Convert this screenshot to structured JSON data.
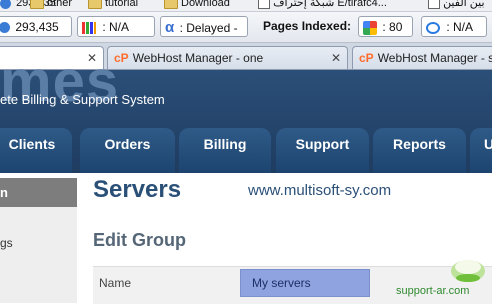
{
  "bookmarks": {
    "counter": "293,435",
    "items": [
      "other",
      "tutorial",
      "Download"
    ],
    "arabic_item": "شبكة إحتراف E/tirafc4...",
    "arabic_right": "بين الفين"
  },
  "toolbar": {
    "alexa_value": "N/A",
    "delayed_label": "Delayed -",
    "pages_indexed_label": "Pages Indexed:",
    "google_count": "80",
    "bing_value": "N/A"
  },
  "tabs": [
    {
      "label": "",
      "active": true
    },
    {
      "label": "WebHost Manager - one",
      "active": false
    },
    {
      "label": "WebHost Manager - s",
      "active": false
    }
  ],
  "header": {
    "logo_text": "mes",
    "tagline": "ete Billing & Support System",
    "nav": [
      "Clients",
      "Orders",
      "Billing",
      "Support",
      "Reports",
      "U"
    ]
  },
  "sidebar": {
    "active_label": "n",
    "item_label": "gs"
  },
  "main": {
    "title": "Servers",
    "domain": "www.multisoft-sy.com",
    "subtitle": "Edit Group",
    "name_label": "Name",
    "name_value": "My servers"
  },
  "watermark": {
    "text": "support-ar.com"
  },
  "colors": {
    "header_bg": "#2b4f78",
    "accent": "#2b5078",
    "input_highlight": "#8ea3e0"
  }
}
